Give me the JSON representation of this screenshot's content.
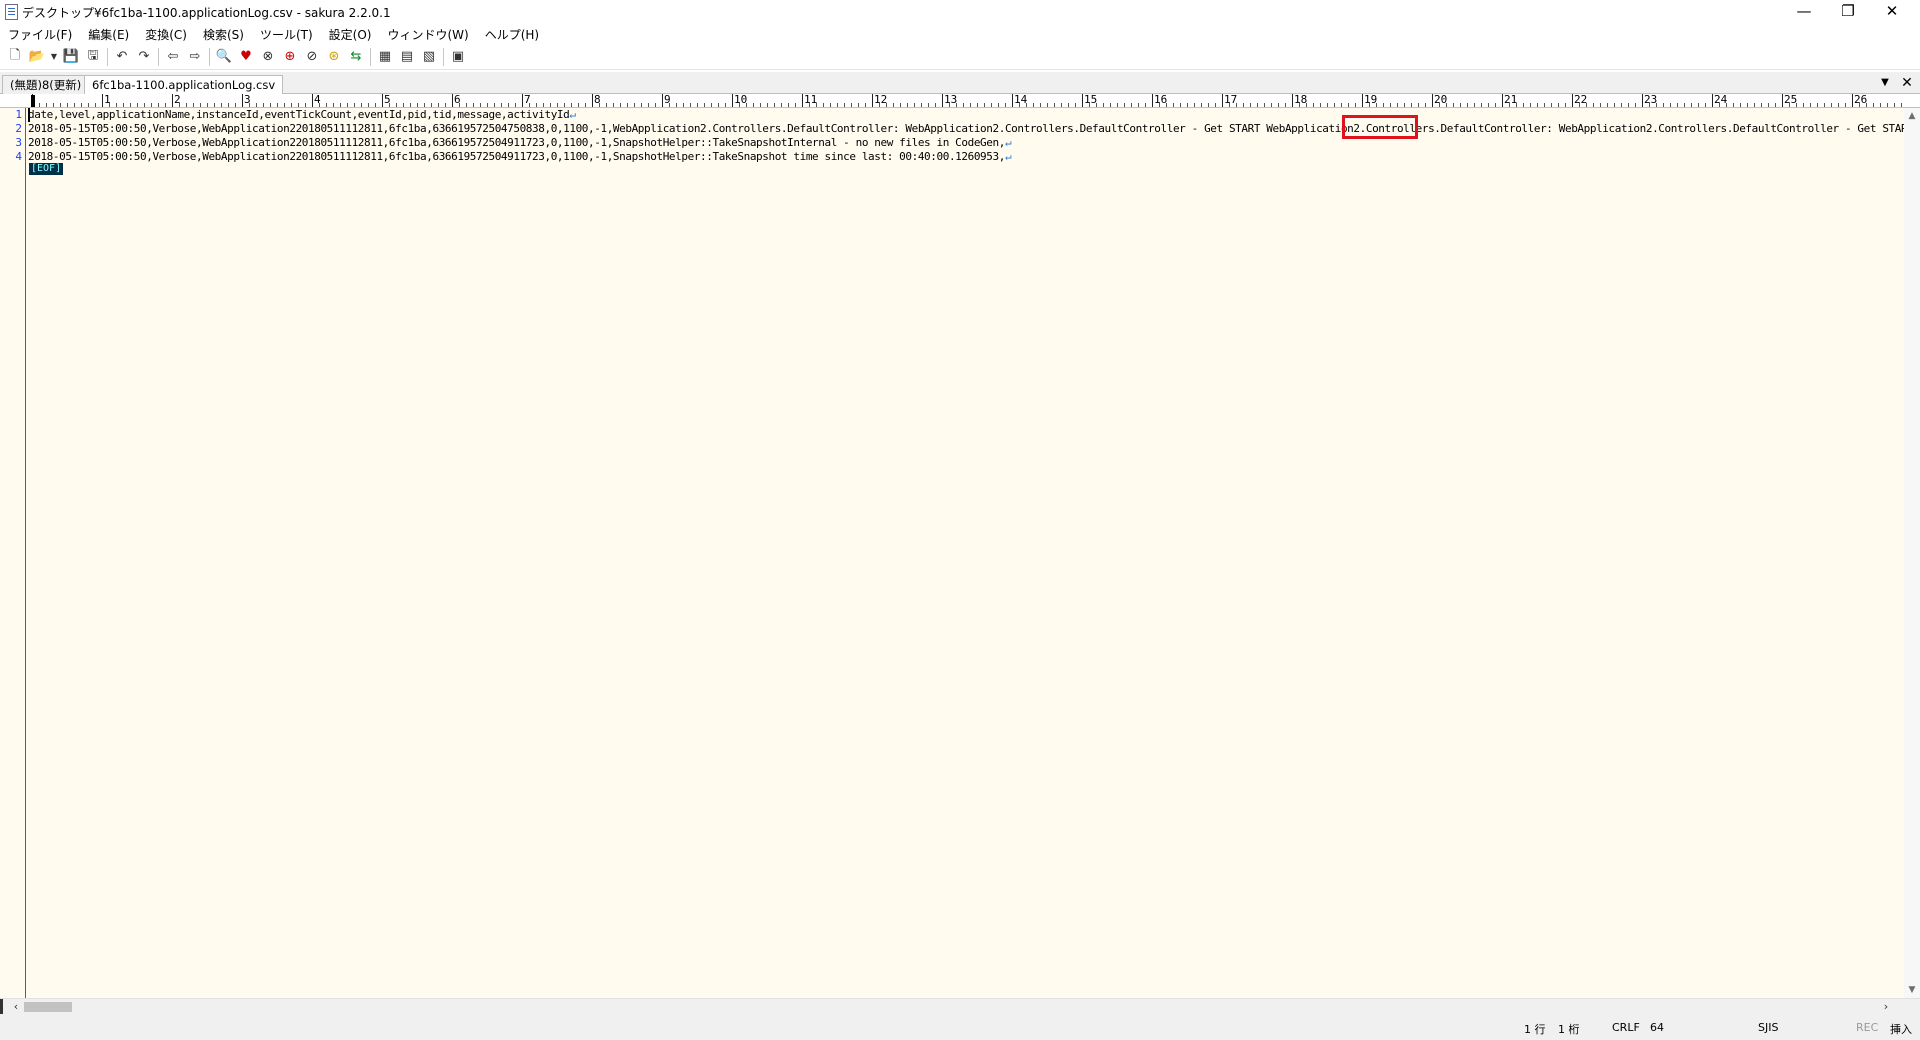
{
  "window": {
    "title": "デスクトップ¥6fc1ba-1100.applicationLog.csv - sakura 2.2.0.1",
    "minimize": "—",
    "restore": "❐",
    "close": "✕"
  },
  "menu": [
    "ファイル(F)",
    "編集(E)",
    "変換(C)",
    "検索(S)",
    "ツール(T)",
    "設定(O)",
    "ウィンドウ(W)",
    "ヘルプ(H)"
  ],
  "toolbar": {
    "icons": [
      "new-file-icon",
      "open-file-icon",
      "dropdown-icon",
      "save-icon",
      "save-all-icon",
      "undo-icon",
      "redo-icon",
      "jump-back-icon",
      "jump-forward-icon",
      "find-icon",
      "find-prev-icon",
      "find-next-icon",
      "find-up-icon",
      "replace-icon",
      "grep-icon",
      "mark-icon",
      "outline-icon",
      "compare-icon",
      "diff-icon",
      "settings-icon"
    ]
  },
  "tabs": [
    {
      "label": "(無題)8(更新)"
    },
    {
      "label": "6fc1ba-1100.applicationLog.csv"
    }
  ],
  "tab_menu": "▼",
  "tab_close": "✕",
  "ruler": {
    "numbers": [
      "1",
      "2",
      "3",
      "4",
      "5",
      "6",
      "7",
      "8",
      "9",
      "10",
      "11",
      "12",
      "13",
      "14",
      "15",
      "16",
      "17",
      "18",
      "19",
      "20",
      "21",
      "22",
      "23",
      "24",
      "25",
      "26"
    ]
  },
  "editor": {
    "lines": [
      {
        "no": "1",
        "text": "date,level,applicationName,instanceId,eventTickCount,eventId,pid,tid,message,activityId",
        "eol": "↵"
      },
      {
        "no": "2",
        "text": "2018-05-15T05:00:50,Verbose,WebApplication220180511112811,6fc1ba,636619572504750838,0,1100,-1,WebApplication2.Controllers.DefaultController: WebApplication2.Controllers.DefaultController - Get START WebApplication2.Controllers.DefaultController: WebApplication2.Controllers.DefaultController - Get START",
        "eol": ""
      },
      {
        "no": "3",
        "text": "2018-05-15T05:00:50,Verbose,WebApplication220180511112811,6fc1ba,636619572504911723,0,1100,-1,SnapshotHelper::TakeSnapshotInternal - no new files in CodeGen,",
        "eol": "↵"
      },
      {
        "no": "4",
        "text": "2018-05-15T05:00:50,Verbose,WebApplication220180511112811,6fc1ba,636619572504911723,0,1100,-1,SnapshotHelper::TakeSnapshot time since last: 00:40:00.1260953,",
        "eol": "↵"
      }
    ],
    "eof": "[EOF]"
  },
  "status": {
    "row": "1 行",
    "col": "1 桁",
    "newline": "CRLF",
    "code": "64",
    "encoding": "SJIS",
    "rec": "REC",
    "mode": "挿入"
  }
}
